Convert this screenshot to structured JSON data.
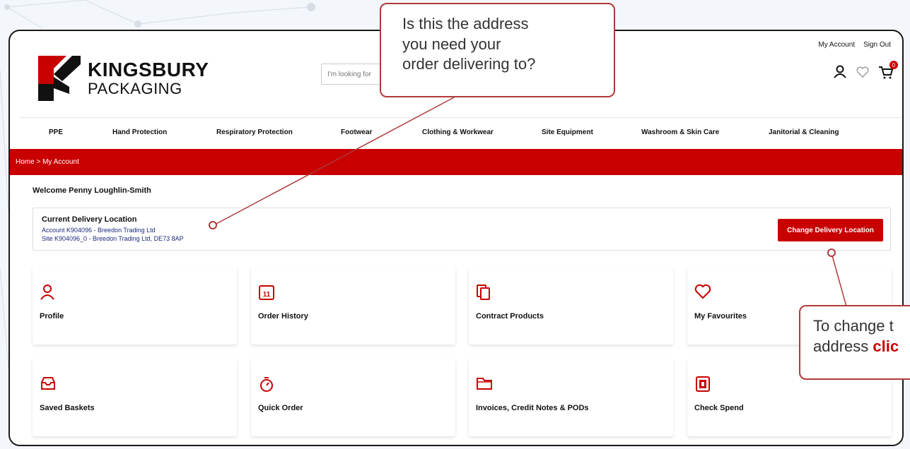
{
  "header": {
    "my_account": "My Account",
    "sign_out": "Sign Out",
    "brand_line1": "KINGSBURY",
    "brand_line2": "PACKAGING",
    "search_placeholder": "I'm looking for",
    "cart_count": "0"
  },
  "nav": [
    "PPE",
    "Hand Protection",
    "Respiratory Protection",
    "Footwear",
    "Clothing & Workwear",
    "Site Equipment",
    "Washroom & Skin Care",
    "Janitorial & Cleaning"
  ],
  "breadcrumb": "Home  >  My Account",
  "welcome": "Welcome Penny Loughlin-Smith",
  "delivery": {
    "title": "Current Delivery Location",
    "account": "Account K904096 - Breedon Trading Ltd",
    "site": "Site K904096_0 - Breedon Trading Ltd, DE73 8AP",
    "button": "Change Delivery Location"
  },
  "cards": [
    {
      "label": "Profile",
      "icon": "user-icon"
    },
    {
      "label": "Order History",
      "icon": "calendar-icon"
    },
    {
      "label": "Contract Products",
      "icon": "documents-icon"
    },
    {
      "label": "My Favourites",
      "icon": "heart-icon"
    },
    {
      "label": "Saved Baskets",
      "icon": "inbox-icon"
    },
    {
      "label": "Quick Order",
      "icon": "stopwatch-icon"
    },
    {
      "label": "Invoices, Credit Notes & PODs",
      "icon": "folder-icon"
    },
    {
      "label": "Check Spend",
      "icon": "wallet-icon"
    }
  ],
  "calendar_day": "11",
  "callouts": {
    "top_line1": "Is this the address",
    "top_line2": "you need your",
    "top_line3": "order delivering to?",
    "right_line1": "To change t",
    "right_line2a": "address ",
    "right_line2b": "clic"
  },
  "colors": {
    "brand_red": "#c80000",
    "callout_border": "#b03a3a",
    "link_blue": "#1c2a7a"
  }
}
